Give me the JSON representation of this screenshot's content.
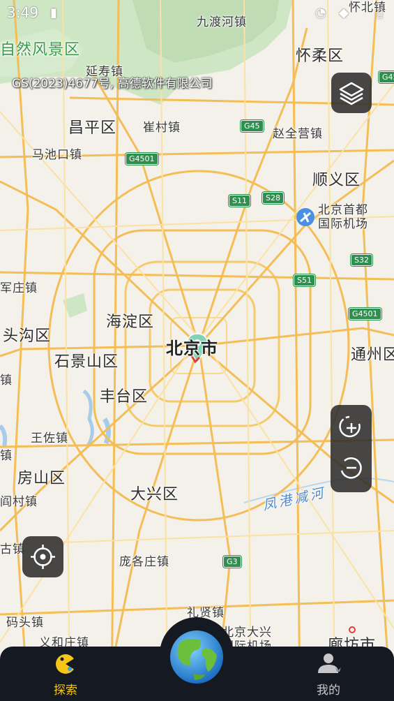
{
  "status_bar": {
    "time": "3:49"
  },
  "map": {
    "copyright": "GS(2023)4677号, 高德软件有限公司",
    "place_labels": [
      {
        "id": "nature",
        "text": "自然风景区"
      },
      {
        "id": "jiuduhe",
        "text": "九渡河镇"
      },
      {
        "id": "huairou",
        "text": "怀柔区"
      },
      {
        "id": "yanshou",
        "text": "延寿镇"
      },
      {
        "id": "changping",
        "text": "昌平区"
      },
      {
        "id": "cuicun",
        "text": "崔村镇"
      },
      {
        "id": "zhaoquanying",
        "text": "赵全营镇"
      },
      {
        "id": "machikou",
        "text": "马池口镇"
      },
      {
        "id": "shunyi",
        "text": "顺义区"
      },
      {
        "id": "airport",
        "text": "北京首都\n国际机场"
      },
      {
        "id": "junzhuang",
        "text": "军庄镇"
      },
      {
        "id": "haidian",
        "text": "海淀区"
      },
      {
        "id": "mentougou",
        "text": "头沟区"
      },
      {
        "id": "beijing",
        "text": "北京市"
      },
      {
        "id": "tongzhou",
        "text": "通州区"
      },
      {
        "id": "shijingshan",
        "text": "石景山区"
      },
      {
        "id": "fengtai",
        "text": "丰台区"
      },
      {
        "id": "wangzuo",
        "text": "王佐镇"
      },
      {
        "id": "fangshan",
        "text": "房山区"
      },
      {
        "id": "daxing",
        "text": "大兴区"
      },
      {
        "id": "yancun",
        "text": "阎村镇"
      },
      {
        "id": "fenggang",
        "text": "凤港减河"
      },
      {
        "id": "gu",
        "text": "古镇"
      },
      {
        "id": "panggezhuang",
        "text": "庞各庄镇"
      },
      {
        "id": "lixian",
        "text": "礼贤镇"
      },
      {
        "id": "matou",
        "text": "码头镇"
      },
      {
        "id": "yiheji",
        "text": "义和庄镇"
      },
      {
        "id": "daxing_airport",
        "text": "北京大兴\n国际机场"
      },
      {
        "id": "langfang",
        "text": "廊坊市"
      },
      {
        "id": "left_zhen",
        "text": "镇"
      },
      {
        "id": "left_zhen2",
        "text": "镇"
      },
      {
        "id": "top_right",
        "text": "怀北镇"
      }
    ],
    "road_shields": [
      "G4501",
      "G45",
      "S11",
      "S28",
      "S32",
      "S51",
      "G4501",
      "G3",
      "G45"
    ]
  },
  "controls": {
    "layers_icon": "layers-icon",
    "zoom_in_icon": "zoom-in-icon",
    "zoom_out_icon": "zoom-out-icon",
    "locate_icon": "locate-icon"
  },
  "bottom_nav": {
    "explore_label": "探索",
    "mine_label": "我的",
    "active_color": "#f5c518",
    "inactive_color": "#c8c8c8"
  }
}
